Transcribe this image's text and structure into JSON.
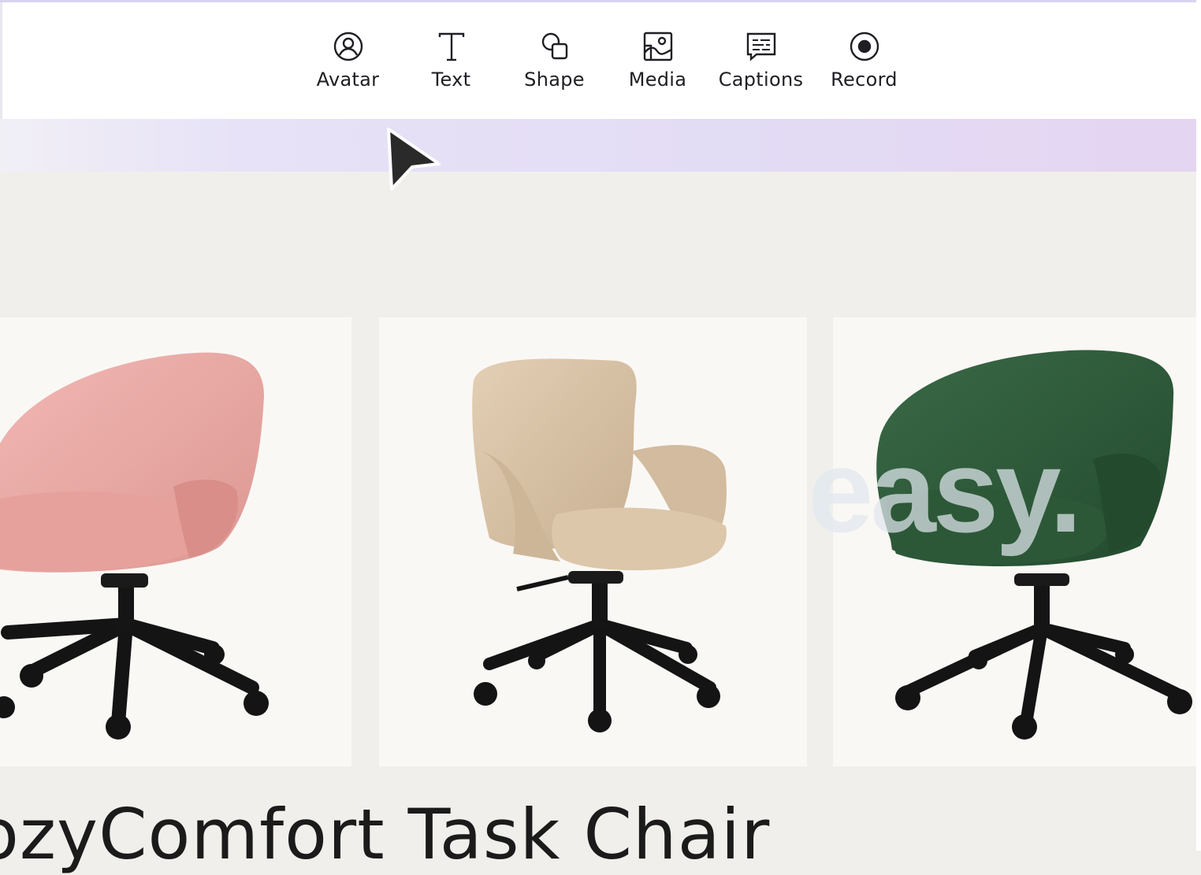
{
  "toolbar": {
    "tools": [
      {
        "label": "Avatar",
        "icon": "avatar-icon"
      },
      {
        "label": "Text",
        "icon": "text-icon"
      },
      {
        "label": "Shape",
        "icon": "shape-icon"
      },
      {
        "label": "Media",
        "icon": "media-icon"
      },
      {
        "label": "Captions",
        "icon": "captions-icon"
      },
      {
        "label": "Record",
        "icon": "record-icon"
      }
    ]
  },
  "canvas": {
    "overlay_text": "easy.",
    "product_title": "ozyComfort Task Chair",
    "chairs": [
      {
        "color_name": "pink",
        "color": "#e9a7a4"
      },
      {
        "color_name": "beige",
        "color": "#d7c2a8"
      },
      {
        "color_name": "green",
        "color": "#2f5a3b"
      }
    ]
  },
  "colors": {
    "accent_band": "#e5dcf5",
    "canvas_bg": "#f1efeb",
    "card_bg": "#faf8f5"
  }
}
